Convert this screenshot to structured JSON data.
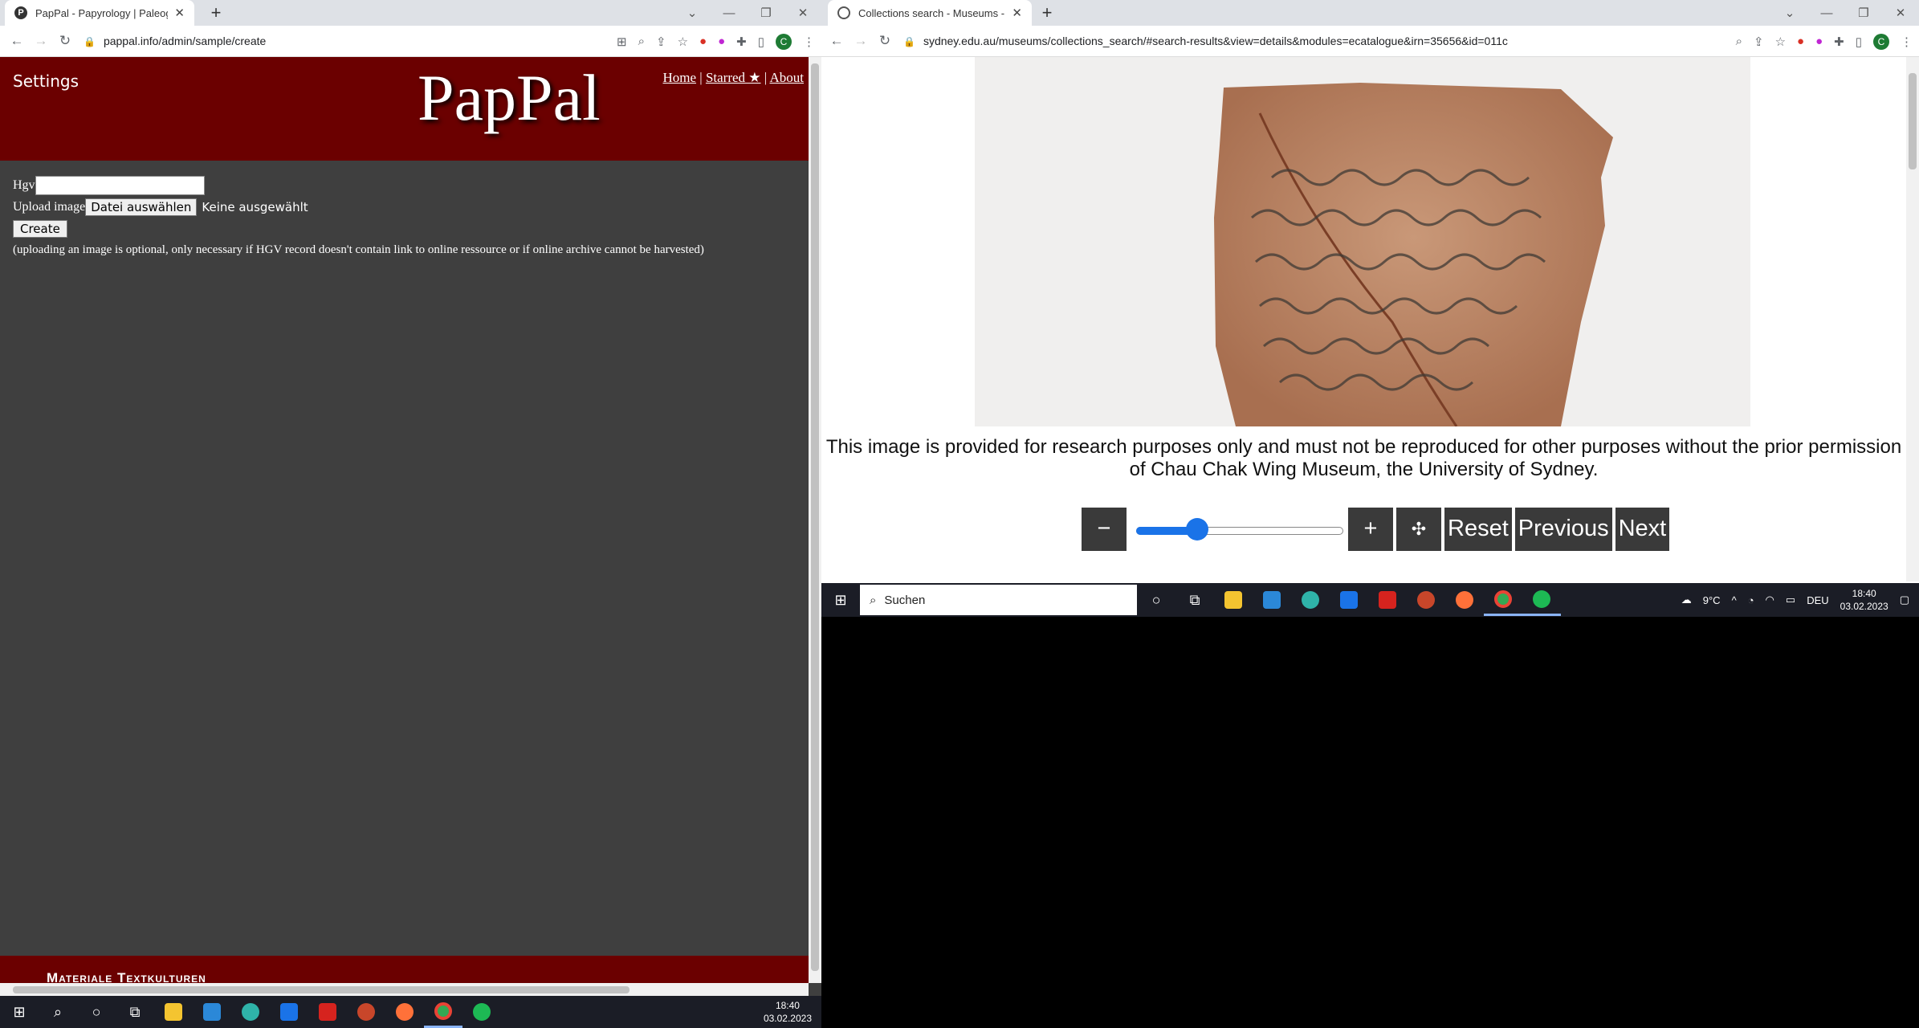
{
  "left_browser": {
    "tab_title": "PapPal - Papyrology | Paleograph",
    "url": "pappal.info/admin/sample/create",
    "page": {
      "settings_label": "Settings",
      "logo": "PapPal",
      "nav": {
        "home": "Home",
        "starred": "Starred ★",
        "about": "About",
        "sep": "|"
      },
      "form": {
        "hgv_label": "Hgv",
        "hgv_value": "",
        "upload_label": "Upload image",
        "file_button": "Datei auswählen",
        "file_status": "Keine ausgewählt",
        "create_button": "Create",
        "note": "(uploading an image is optional, only necessary if HGV record doesn't contain link to online ressource or if online archive cannot be harvested)"
      },
      "footer_text": "Materiale Textkulturen"
    }
  },
  "right_browser": {
    "tab_title": "Collections search - Museums - T",
    "url": "sydney.edu.au/museums/collections_search/#search-results&view=details&modules=ecatalogue&irn=35656&id=011c",
    "caption": "This image is provided for research purposes only and must not be reproduced for other purposes without the prior permission of Chau Chak Wing Museum, the University of Sydney.",
    "controls": {
      "zoom_out": "−",
      "zoom_in": "+",
      "reset": "Reset",
      "previous": "Previous",
      "next": "Next",
      "zoom_level": 0.27
    }
  },
  "taskbar_left": {
    "time": "18:40",
    "date": "03.02.2023"
  },
  "taskbar_right": {
    "search_placeholder": "Suchen",
    "weather": "9°C",
    "lang": "DEU",
    "time": "18:40",
    "date": "03.02.2023"
  }
}
